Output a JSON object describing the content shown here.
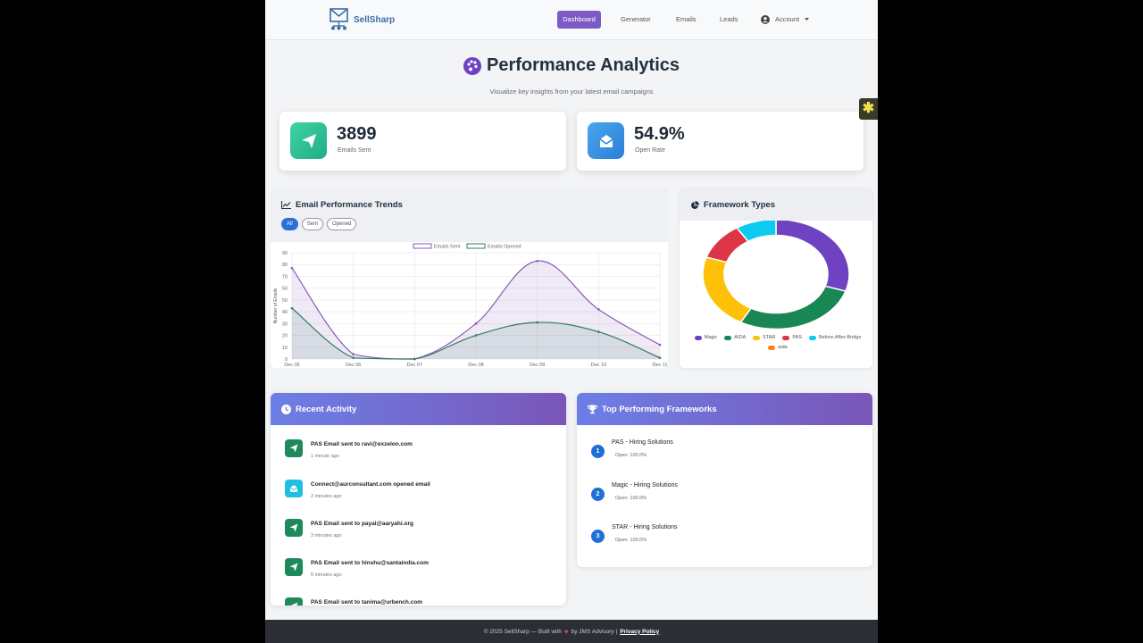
{
  "brand": {
    "name": "SellSharp"
  },
  "nav": {
    "items": [
      {
        "label": "Dashboard",
        "active": true
      },
      {
        "label": "Generator"
      },
      {
        "label": "Emails"
      },
      {
        "label": "Leads"
      }
    ],
    "account_label": "Account"
  },
  "header": {
    "title": "Performance Analytics",
    "subtitle": "Visualize key insights from your latest email campaigns"
  },
  "stats": {
    "emails_sent": {
      "value": "3899",
      "label": "Emails Sent"
    },
    "open_rate": {
      "value": "54.9%",
      "label": "Open Rate"
    }
  },
  "trends": {
    "title": "Email Performance Trends",
    "filters": [
      "All",
      "Sent",
      "Opened"
    ],
    "active_filter": "All"
  },
  "types": {
    "title": "Framework Types"
  },
  "chart_data": [
    {
      "type": "area",
      "title": "",
      "xlabel": "",
      "ylabel": "Number of Emails",
      "categories": [
        "Dec 05",
        "Dec 06",
        "Dec 07",
        "Dec 08",
        "Dec 09",
        "Dec 10",
        "Dec 11"
      ],
      "ylim": [
        0,
        90
      ],
      "yticks": [
        0,
        10,
        20,
        30,
        40,
        50,
        60,
        70,
        80,
        90
      ],
      "grid": true,
      "legend": "top",
      "series": [
        {
          "name": "Emails Sent",
          "values": [
            77,
            4,
            0,
            30,
            83,
            42,
            12
          ],
          "color": "#8a5ab8"
        },
        {
          "name": "Emails Opened",
          "values": [
            43,
            1,
            0,
            20,
            31,
            23,
            1
          ],
          "color": "#2f7d62"
        }
      ]
    },
    {
      "type": "pie",
      "variant": "doughnut",
      "legend": "bottom",
      "labels": [
        "Magic",
        "AIDA",
        "STAR",
        "PAS",
        "Before-After-Bridge",
        "aida"
      ],
      "values": [
        30,
        28,
        22,
        11,
        9,
        0
      ],
      "colors": [
        "#6f42c1",
        "#198754",
        "#ffc107",
        "#dc3545",
        "#0dcaf0",
        "#fd7e14"
      ]
    }
  ],
  "activity": {
    "title": "Recent Activity",
    "items": [
      {
        "text": "PAS Email sent to ravi@exzelon.com",
        "time": "1 minute ago",
        "kind": "sent"
      },
      {
        "text": "Connect@aurconsultant.com opened email",
        "time": "2 minutes ago",
        "kind": "opened"
      },
      {
        "text": "PAS Email sent to payal@aaryahi.org",
        "time": "3 minutes ago",
        "kind": "sent"
      },
      {
        "text": "PAS Email sent to hinshu@santaindia.com",
        "time": "6 minutes ago",
        "kind": "sent"
      },
      {
        "text": "PAS Email sent to tanima@urbench.com",
        "time": "",
        "kind": "sent"
      }
    ]
  },
  "top_frameworks": {
    "title": "Top Performing Frameworks",
    "items": [
      {
        "rank": "1",
        "name": "PAS - Hiring Solutions",
        "open": "Open: 100.0%"
      },
      {
        "rank": "2",
        "name": "Magic - Hiring Solutions",
        "open": "Open: 100.0%"
      },
      {
        "rank": "3",
        "name": "STAR - Hiring Solutions",
        "open": "Open: 100.0%"
      }
    ]
  },
  "footer": {
    "text_before": "© 2025 SellSharp — Built with",
    "text_after": "by JMS Advisory |",
    "link": "Privacy Policy"
  }
}
